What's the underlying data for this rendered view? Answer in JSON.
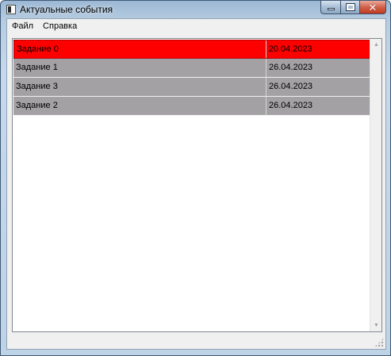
{
  "window": {
    "title": "Актуальные события",
    "controls": {
      "minimize": "",
      "maximize": "",
      "close": "✕"
    }
  },
  "menu": {
    "items": [
      {
        "label": "Файл"
      },
      {
        "label": "Справка"
      }
    ]
  },
  "tasks": {
    "rows": [
      {
        "name": "Задание 0",
        "date": "20.04.2023",
        "color": "#ff0000",
        "selected": true
      },
      {
        "name": "Задание 1",
        "date": "26.04.2023",
        "color": "#a3a1a3",
        "selected": false
      },
      {
        "name": "Задание 3",
        "date": "26.04.2023",
        "color": "#a3a1a3",
        "selected": false
      },
      {
        "name": "Задание 2",
        "date": "26.04.2023",
        "color": "#a3a1a3",
        "selected": false
      }
    ]
  },
  "scrollbar": {
    "up_icon": "triangle-up-icon",
    "down_icon": "triangle-down-icon"
  }
}
